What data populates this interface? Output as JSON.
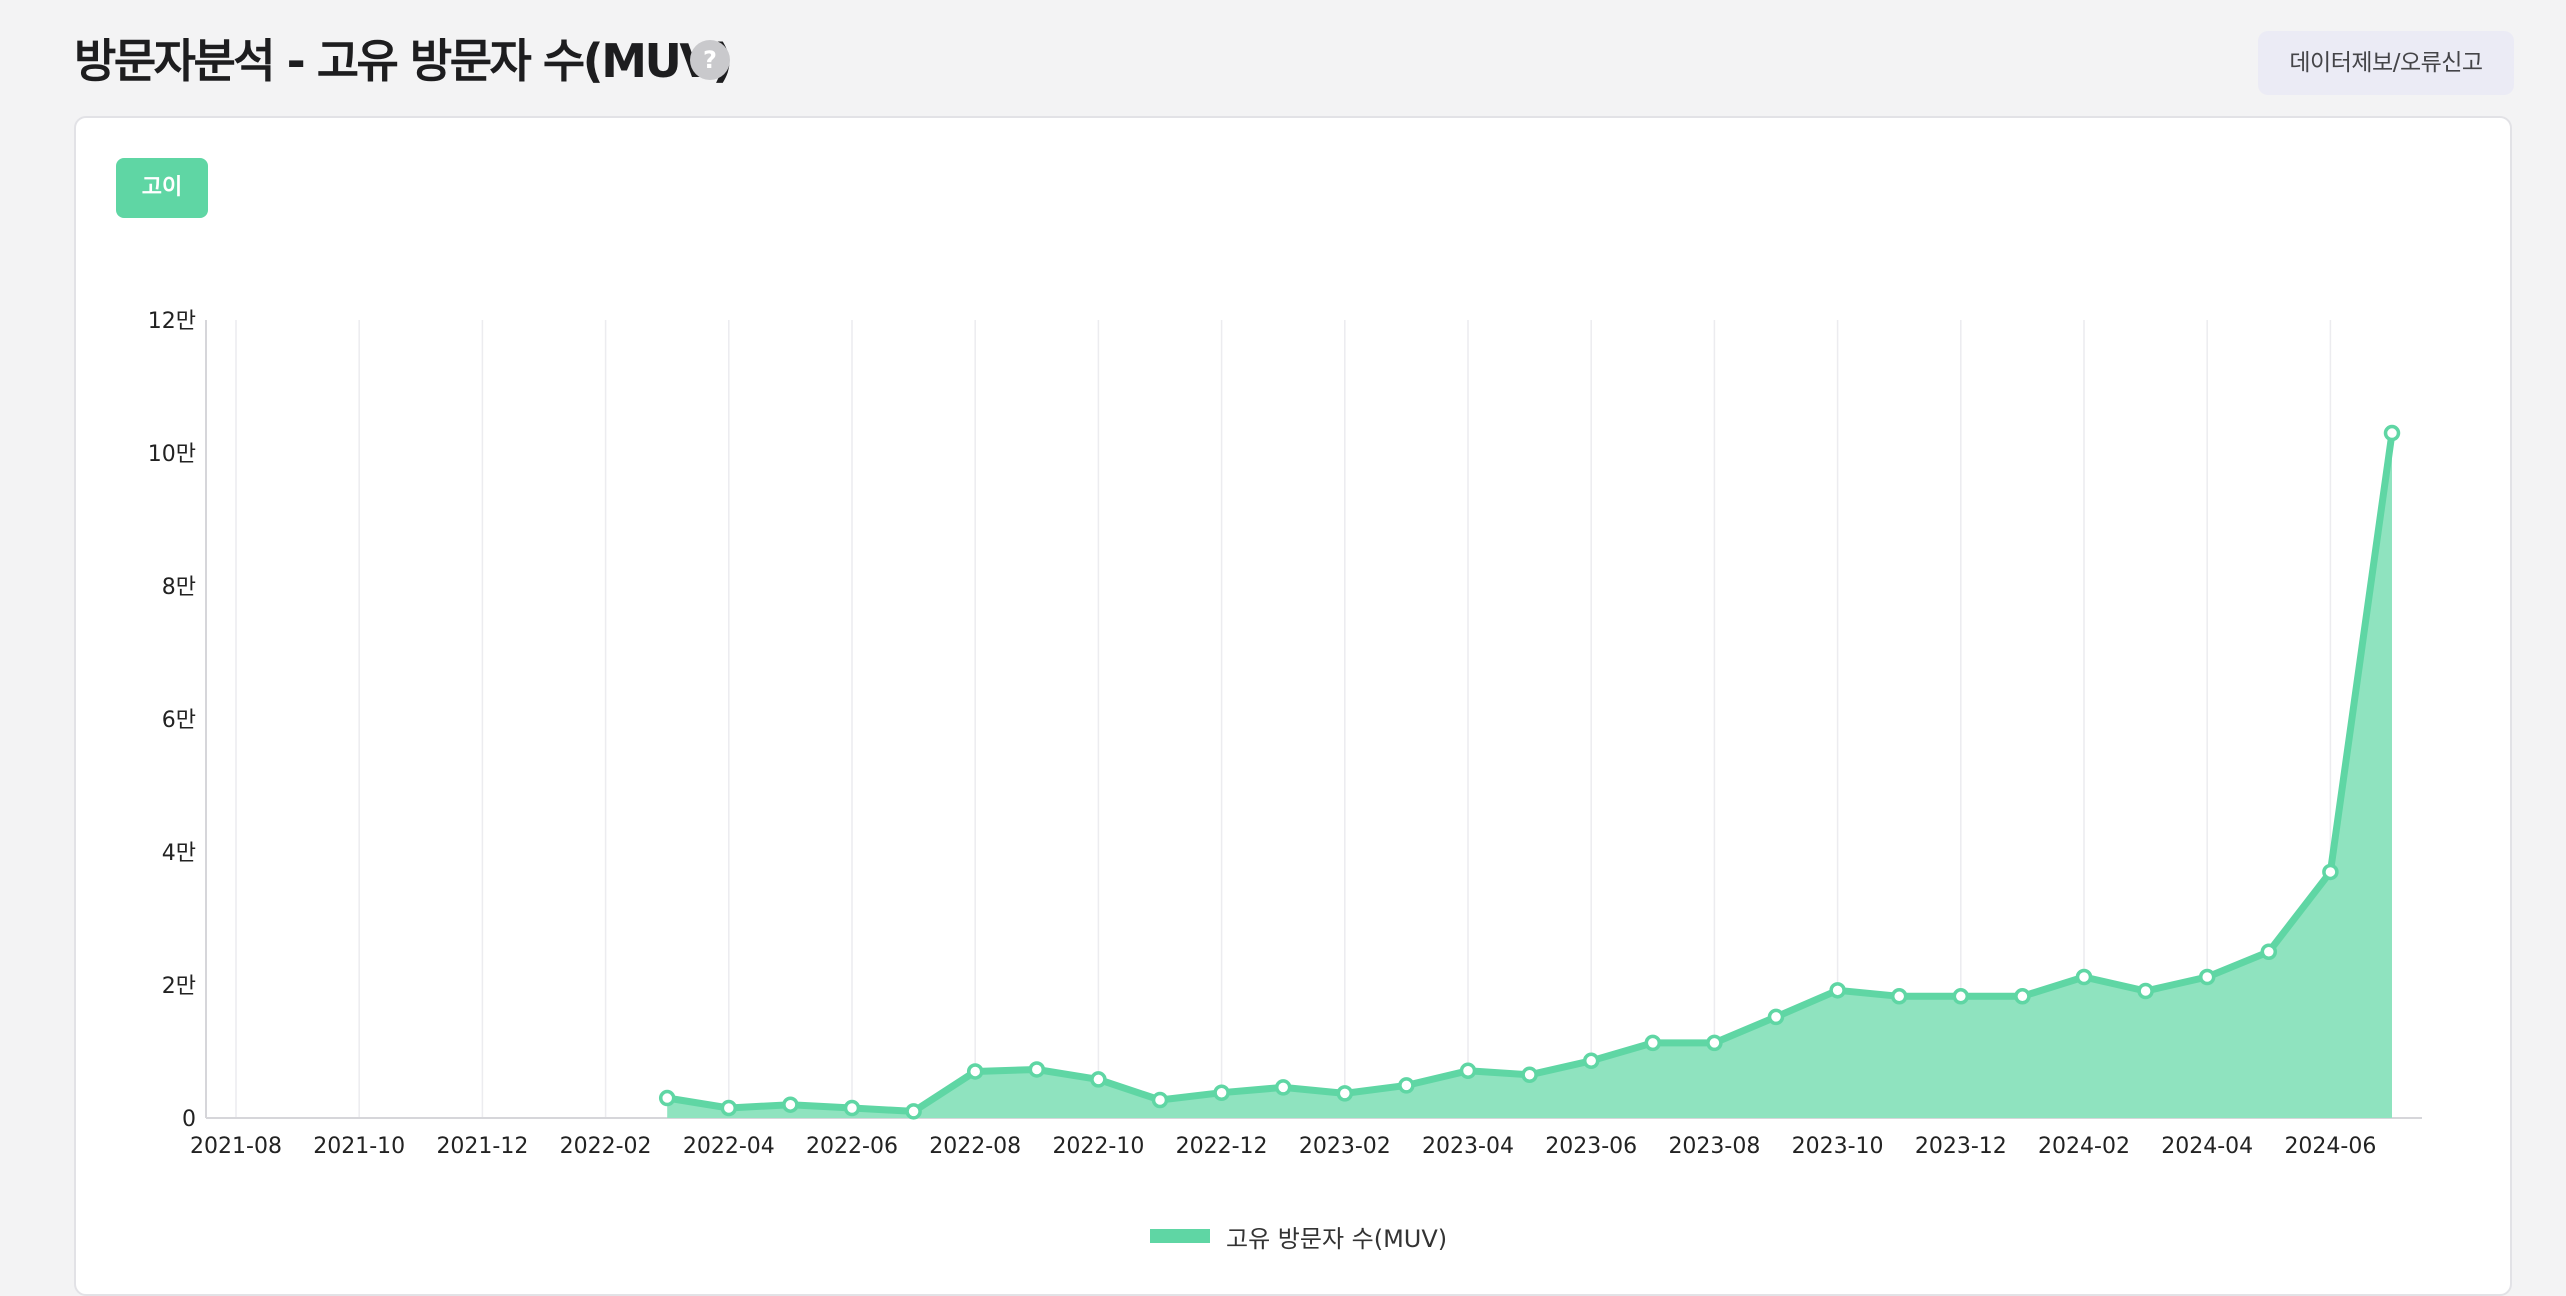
{
  "header": {
    "title": "방문자분석 - 고유 방문자 수(MUV)",
    "help_icon": "?",
    "report_button": "데이터제보/오류신고"
  },
  "app_chip": "고이",
  "colors": {
    "accent": "#5fd6a4",
    "area_fill": "#8fe3bf",
    "background": "#f3f3f4"
  },
  "chart_data": {
    "type": "area",
    "series": [
      {
        "name": "고유 방문자 수(MUV)",
        "x": [
          "2022-03",
          "2022-04",
          "2022-05",
          "2022-06",
          "2022-07",
          "2022-08",
          "2022-09",
          "2022-10",
          "2022-11",
          "2022-12",
          "2023-01",
          "2023-02",
          "2023-03",
          "2023-04",
          "2023-05",
          "2023-06",
          "2023-07",
          "2023-08",
          "2023-09",
          "2023-10",
          "2023-11",
          "2023-12",
          "2024-01",
          "2024-02",
          "2024-03",
          "2024-04",
          "2024-05",
          "2024-06",
          "2024-07"
        ],
        "values": [
          3000,
          1500,
          2000,
          1500,
          1000,
          7000,
          7300,
          5800,
          2700,
          3800,
          4600,
          3700,
          4900,
          7100,
          6500,
          8600,
          11300,
          11300,
          15200,
          19200,
          18300,
          18300,
          18300,
          21200,
          19100,
          21200,
          25000,
          37000,
          103000
        ]
      }
    ],
    "x_ticks": [
      "2021-08",
      "2021-10",
      "2021-12",
      "2022-02",
      "2022-04",
      "2022-06",
      "2022-08",
      "2022-10",
      "2022-12",
      "2023-02",
      "2023-04",
      "2023-06",
      "2023-08",
      "2023-10",
      "2023-12",
      "2024-02",
      "2024-04",
      "2024-06"
    ],
    "y_ticks": [
      {
        "value": 0,
        "label": "0"
      },
      {
        "value": 20000,
        "label": "2만"
      },
      {
        "value": 40000,
        "label": "4만"
      },
      {
        "value": 60000,
        "label": "6만"
      },
      {
        "value": 80000,
        "label": "8만"
      },
      {
        "value": 100000,
        "label": "10만"
      },
      {
        "value": 120000,
        "label": "12만"
      }
    ],
    "xlim": [
      "2021-08",
      "2024-07"
    ],
    "ylim": [
      0,
      120000
    ],
    "grid": "vertical",
    "legend": "bottom-center",
    "title": "",
    "xlabel": "",
    "ylabel": ""
  }
}
